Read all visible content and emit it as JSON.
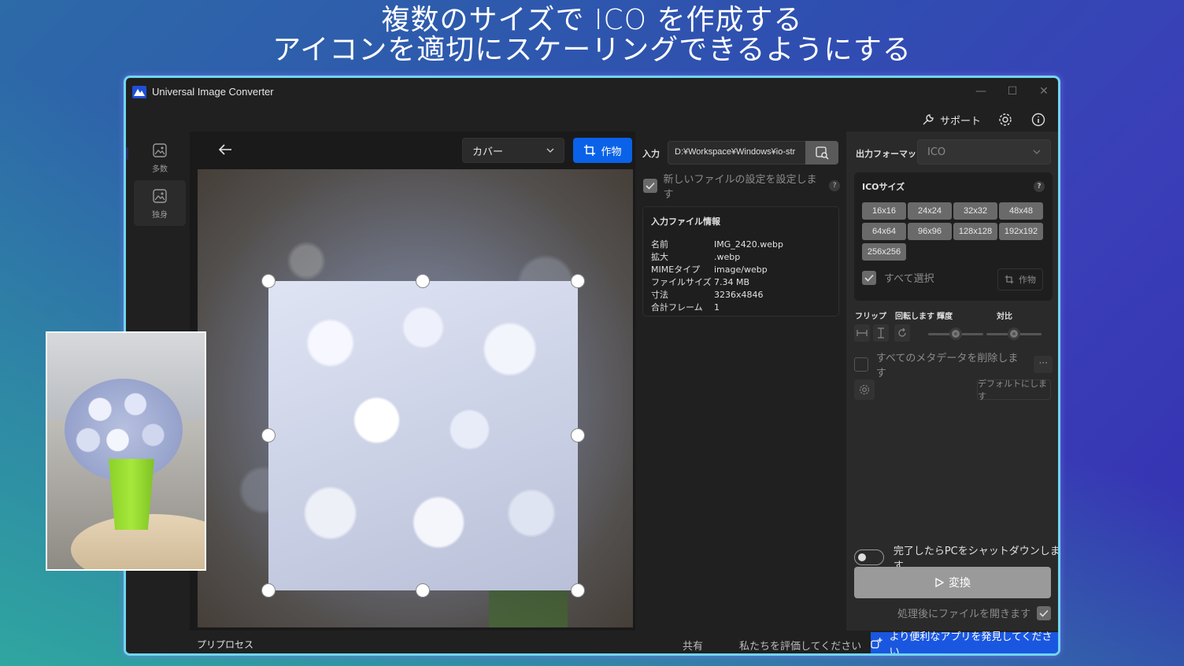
{
  "promo": {
    "line1": "複数のサイズで ICO を作成する",
    "line2": "アイコンを適切にスケーリングできるようにする"
  },
  "window": {
    "title": "Universal Image Converter",
    "controls": {
      "minimize": "—",
      "maximize": "☐",
      "close": "✕"
    }
  },
  "toolbar": {
    "support_label": "サポート"
  },
  "nav": {
    "items": [
      {
        "label": "多数",
        "icon": "multi-image-icon"
      },
      {
        "label": "独身",
        "icon": "single-image-icon"
      }
    ]
  },
  "editor": {
    "crop_mode": "カバー",
    "crop_button": "作物"
  },
  "input": {
    "label": "入力",
    "path": "D:¥Workspace¥Windows¥io-str",
    "apply_new_files": "新しいファイルの設定を設定します",
    "help": "?"
  },
  "file_info": {
    "title": "入力ファイル情報",
    "rows": [
      {
        "key": "名前",
        "value": "IMG_2420.webp"
      },
      {
        "key": "拡大",
        "value": ".webp"
      },
      {
        "key": "MIMEタイプ",
        "value": "image/webp"
      },
      {
        "key": "ファイルサイズ",
        "value": "7.34 MB"
      },
      {
        "key": "寸法",
        "value": "3236x4846"
      },
      {
        "key": "合計フレーム",
        "value": "1"
      }
    ]
  },
  "output": {
    "format_label": "出力フォーマット",
    "format_value": "ICO",
    "ico_title": "ICOサイズ",
    "sizes": [
      "16x16",
      "24x24",
      "32x32",
      "48x48",
      "64x64",
      "96x96",
      "128x128",
      "192x192",
      "256x256"
    ],
    "select_all": "すべて選択",
    "crop_button": "作物",
    "flip_label": "フリップ",
    "rotate_label": "回転します",
    "brightness_label": "輝度",
    "contrast_label": "対比",
    "brightness_value": 0.5,
    "contrast_value": 0.5,
    "strip_metadata": "すべてのメタデータを削除します",
    "more": "···",
    "default_button": "デフォルトにします",
    "shutdown_label": "完了したらPCをシャットダウンします",
    "convert_button": "変換",
    "open_after": "処理後にファイルを開きます"
  },
  "statusbar": {
    "preprocess": "プリプロセス",
    "share": "共有",
    "rate": "私たちを評価してください",
    "discover": "より便利なアプリを発見してください"
  },
  "colors": {
    "accent": "#0a62e8",
    "window_border": "#6fd6f0",
    "discover_bg": "#1a57e0"
  }
}
